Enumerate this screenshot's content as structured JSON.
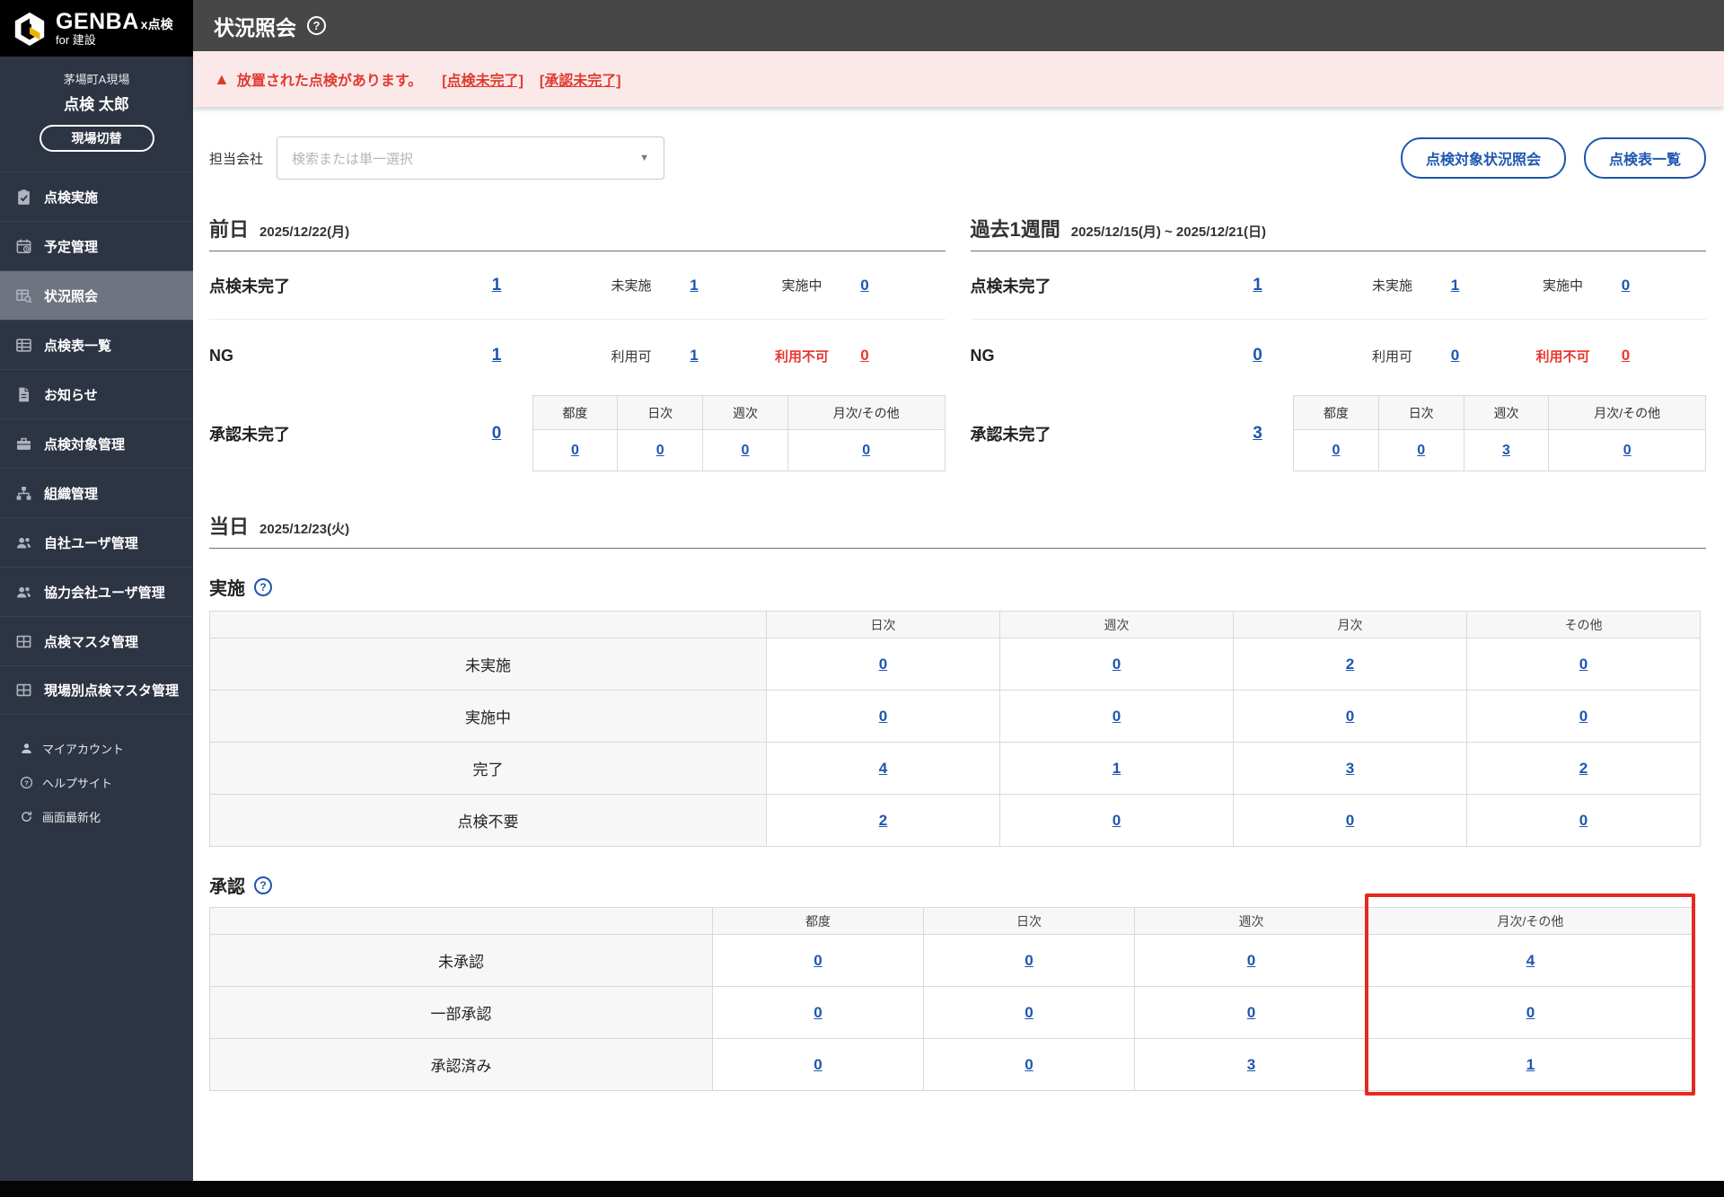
{
  "colors": {
    "link_blue": "#1e56b0",
    "alert_red": "#e03a2f",
    "highlight_red": "#e52a20",
    "sidebar_navy": "#2d3443",
    "topbar_gray": "#474747",
    "brand_yellow": "#f0b400"
  },
  "sidebar": {
    "logo": {
      "brand": "GENBA",
      "x": "x点検",
      "sub": "for 建設"
    },
    "site_name": "茅場町A現場",
    "user_name": "点検 太郎",
    "switch_site_label": "現場切替",
    "menu": [
      {
        "label": "点検実施",
        "icon": "clipboard-check-icon"
      },
      {
        "label": "予定管理",
        "icon": "calendar-clock-icon"
      },
      {
        "label": "状況照会",
        "icon": "status-search-icon",
        "active": true
      },
      {
        "label": "点検表一覧",
        "icon": "sheet-list-icon"
      },
      {
        "label": "お知らせ",
        "icon": "document-icon"
      },
      {
        "label": "点検対象管理",
        "icon": "briefcase-icon"
      },
      {
        "label": "組織管理",
        "icon": "org-chart-icon"
      },
      {
        "label": "自社ユーザ管理",
        "icon": "users-icon"
      },
      {
        "label": "協力会社ユーザ管理",
        "icon": "users-icon"
      },
      {
        "label": "点検マスタ管理",
        "icon": "grid-icon"
      },
      {
        "label": "現場別点検マスタ管理",
        "icon": "grid-icon"
      }
    ],
    "utility": [
      {
        "label": "マイアカウント",
        "icon": "person-icon"
      },
      {
        "label": "ヘルプサイト",
        "icon": "help-circle-icon"
      },
      {
        "label": "画面最新化",
        "icon": "refresh-icon"
      }
    ]
  },
  "header": {
    "title": "状況照会"
  },
  "alert": {
    "message": "放置された点検があります。",
    "links": [
      "[点検未完了]",
      "[承認未完了]"
    ]
  },
  "filter": {
    "label": "担当会社",
    "placeholder": "検索または単一選択"
  },
  "actions": {
    "buttons": [
      "点検対象状況照会",
      "点検表一覧"
    ]
  },
  "summary": {
    "periods": [
      {
        "title": "前日",
        "date": "2025/12/22(月)",
        "incomplete": {
          "label": "点検未完了",
          "total": "1",
          "items": [
            {
              "label": "未実施",
              "value": "1"
            },
            {
              "label": "実施中",
              "value": "0"
            }
          ]
        },
        "ng": {
          "label": "NG",
          "total": "1",
          "ok_label": "利用可",
          "ok_value": "1",
          "bad_label": "利用不可",
          "bad_value": "0"
        },
        "approval": {
          "label": "承認未完了",
          "total": "0",
          "columns": [
            "都度",
            "日次",
            "週次",
            "月次/その他"
          ],
          "values": [
            "0",
            "0",
            "0",
            "0"
          ]
        }
      },
      {
        "title": "過去1週間",
        "date": "2025/12/15(月) ~ 2025/12/21(日)",
        "incomplete": {
          "label": "点検未完了",
          "total": "1",
          "items": [
            {
              "label": "未実施",
              "value": "1"
            },
            {
              "label": "実施中",
              "value": "0"
            }
          ]
        },
        "ng": {
          "label": "NG",
          "total": "0",
          "ok_label": "利用可",
          "ok_value": "0",
          "bad_label": "利用不可",
          "bad_value": "0"
        },
        "approval": {
          "label": "承認未完了",
          "total": "3",
          "columns": [
            "都度",
            "日次",
            "週次",
            "月次/その他"
          ],
          "values": [
            "0",
            "0",
            "3",
            "0"
          ]
        }
      }
    ]
  },
  "today": {
    "title": "当日",
    "date": "2025/12/23(火)"
  },
  "jisshi": {
    "title": "実施",
    "columns": [
      "日次",
      "週次",
      "月次",
      "その他"
    ],
    "rows": [
      {
        "label": "未実施",
        "values": [
          "0",
          "0",
          "2",
          "0"
        ]
      },
      {
        "label": "実施中",
        "values": [
          "0",
          "0",
          "0",
          "0"
        ]
      },
      {
        "label": "完了",
        "values": [
          "4",
          "1",
          "3",
          "2"
        ]
      },
      {
        "label": "点検不要",
        "values": [
          "2",
          "0",
          "0",
          "0"
        ]
      }
    ]
  },
  "shounin": {
    "title": "承認",
    "columns": [
      "都度",
      "日次",
      "週次",
      "月次/その他"
    ],
    "highlighted_column": "月次/その他",
    "rows": [
      {
        "label": "未承認",
        "values": [
          "0",
          "0",
          "0",
          "4"
        ]
      },
      {
        "label": "一部承認",
        "values": [
          "0",
          "0",
          "0",
          "0"
        ]
      },
      {
        "label": "承認済み",
        "values": [
          "0",
          "0",
          "3",
          "1"
        ]
      }
    ]
  }
}
